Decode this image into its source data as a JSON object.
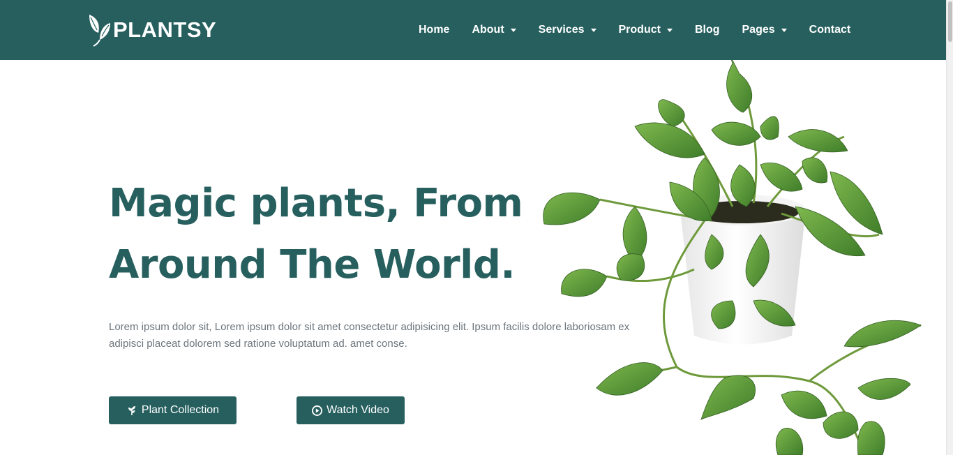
{
  "brand": {
    "name": "PLANTSY",
    "icon": "leaf-logo-icon"
  },
  "nav": {
    "items": [
      {
        "label": "Home",
        "dropdown": false
      },
      {
        "label": "About",
        "dropdown": true
      },
      {
        "label": "Services",
        "dropdown": true
      },
      {
        "label": "Product",
        "dropdown": true
      },
      {
        "label": "Blog",
        "dropdown": false
      },
      {
        "label": "Pages",
        "dropdown": true
      },
      {
        "label": "Contact",
        "dropdown": false
      }
    ]
  },
  "hero": {
    "title_line1": "Magic plants, From",
    "title_line2": "Around The World.",
    "text": "Lorem ipsum dolor sit, Lorem ipsum dolor sit amet consectetur adipisicing elit. Ipsum facilis dolore laboriosam ex adipisci placeat dolorem sed ratione voluptatum ad. amet conse.",
    "primary_button": "Plant Collection",
    "secondary_button": "Watch Video",
    "image": "potted-pothos-plant"
  },
  "colors": {
    "brand_green": "#275f5f",
    "text_muted": "#6c757d",
    "leaf": "#5a9a3a",
    "background": "#ffffff"
  }
}
